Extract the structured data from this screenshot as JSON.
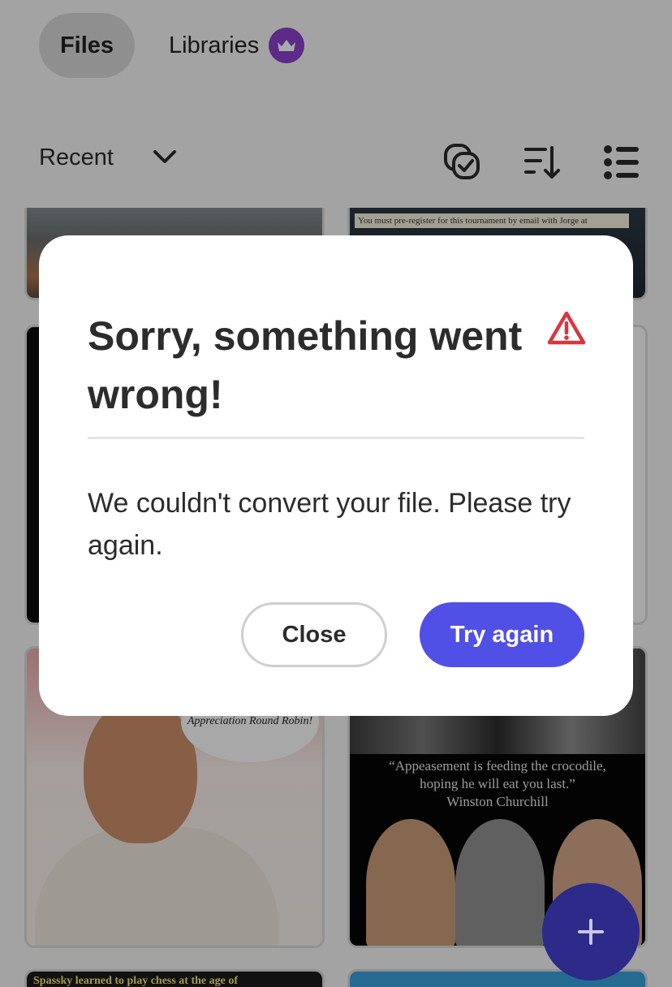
{
  "tabs": {
    "files": "Files",
    "libraries": "Libraries"
  },
  "toolbar": {
    "sort_label": "Recent",
    "icons": [
      "select-multiple-icon",
      "sort-icon",
      "list-view-icon"
    ]
  },
  "thumbnails": {
    "flyer_text": "You must pre-register for this tournament by email with Jorge at",
    "man_bubble": "Appreciation Round Robin!",
    "quote_line1": "“Appeasement is feeding the crocodile,",
    "quote_line2": "hoping he will eat you last.”",
    "quote_author": "Winston Churchill",
    "bottom_left_text": "Spassky learned to play chess at the age of"
  },
  "dialog": {
    "title": "Sorry, something went wrong!",
    "message": "We couldn't convert your file. Please try again.",
    "close_label": "Close",
    "try_again_label": "Try again"
  },
  "colors": {
    "accent": "#5150e6",
    "warning": "#d7373f",
    "premium": "#8a3fc9"
  }
}
